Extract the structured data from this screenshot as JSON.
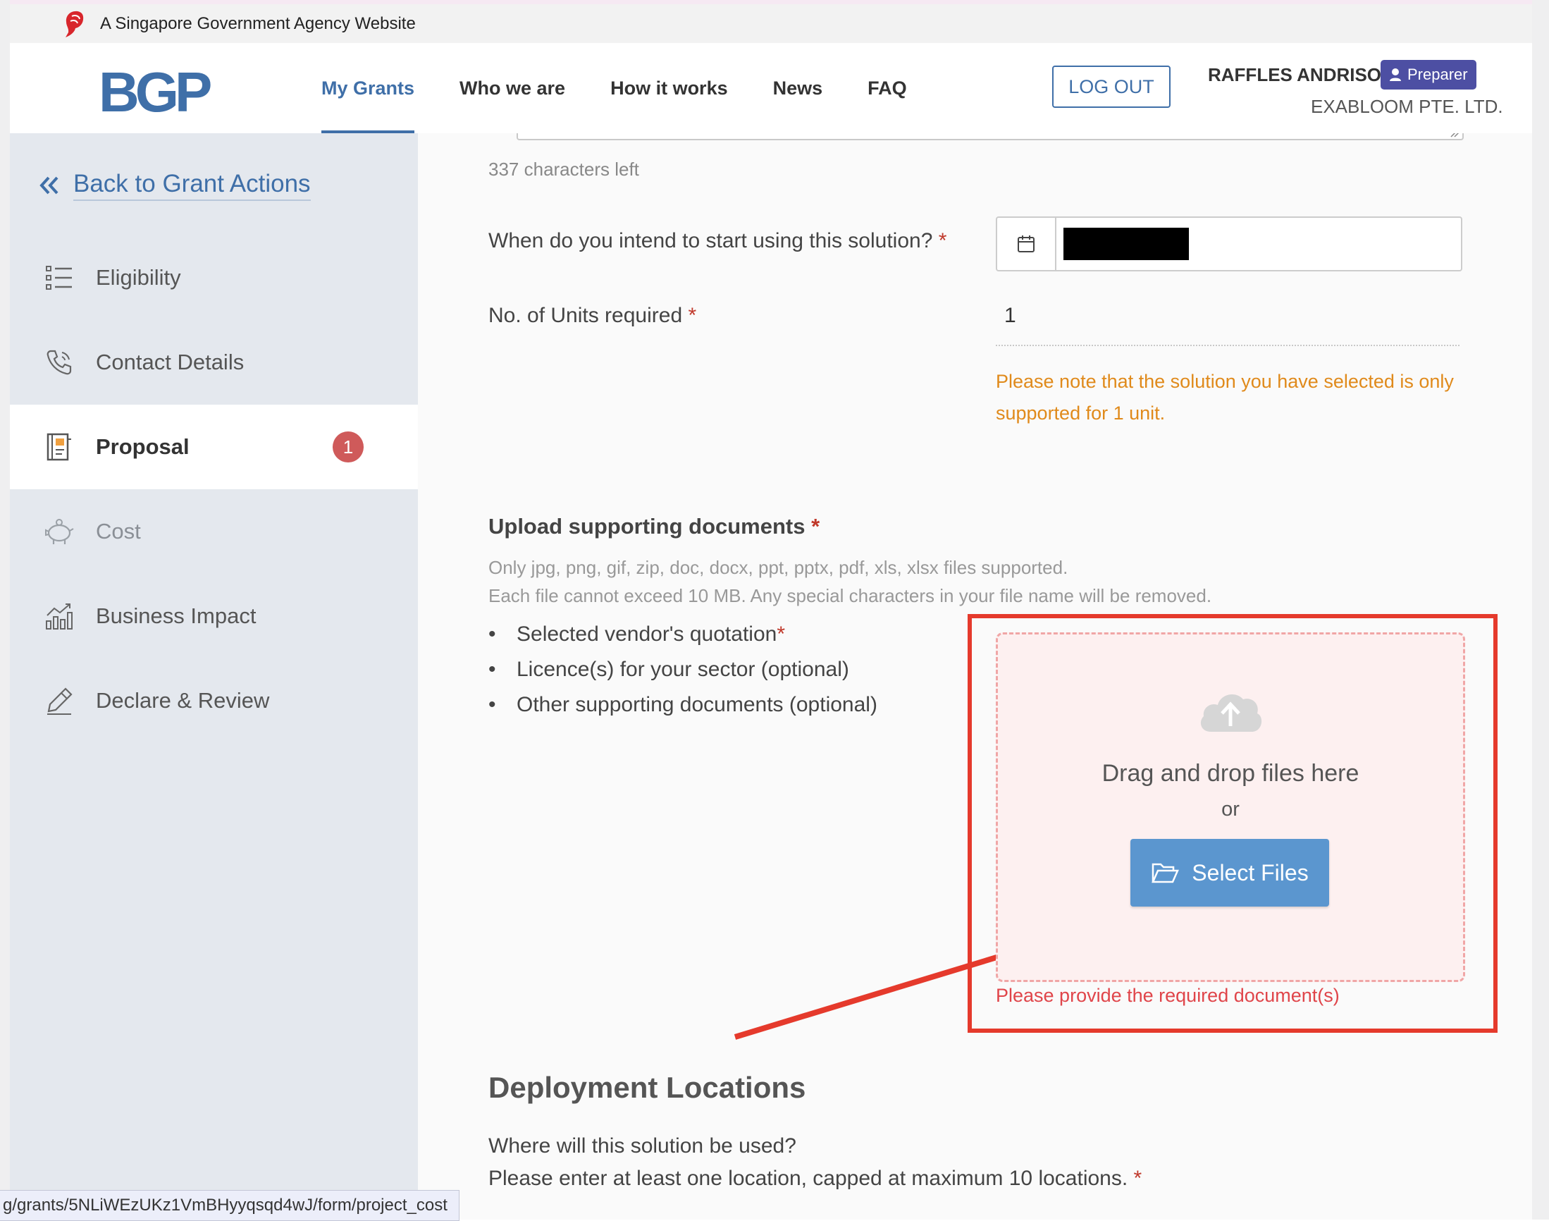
{
  "masthead": {
    "text": "A Singapore Government Agency Website"
  },
  "header": {
    "logo": "BGP",
    "nav": [
      {
        "label": "My Grants",
        "active": true
      },
      {
        "label": "Who we are"
      },
      {
        "label": "How it works"
      },
      {
        "label": "News"
      },
      {
        "label": "FAQ"
      }
    ],
    "logout_label": "LOG OUT",
    "user_name": "RAFFLES ANDRISON",
    "role": "Preparer",
    "company": "EXABLOOM PTE. LTD."
  },
  "sidebar": {
    "back_label": "Back to Grant Actions",
    "items": [
      {
        "label": "Eligibility",
        "icon": "list-icon"
      },
      {
        "label": "Contact Details",
        "icon": "phone-icon"
      },
      {
        "label": "Proposal",
        "icon": "notebook-icon",
        "active": true,
        "badge": "1"
      },
      {
        "label": "Cost",
        "icon": "piggy-bank-icon",
        "disabled": true
      },
      {
        "label": "Business Impact",
        "icon": "chart-icon"
      },
      {
        "label": "Declare & Review",
        "icon": "pen-icon"
      }
    ]
  },
  "form": {
    "chars_left": "337 characters left",
    "start_question": "When do you intend to start using this solution?",
    "units_question": "No. of Units required",
    "units_value": "1",
    "units_note": "Please note that the solution you have selected is only supported for 1 unit.",
    "required_mark": "*",
    "upload": {
      "title": "Upload supporting documents",
      "help_line1": "Only jpg, png, gif, zip, doc, docx, ppt, pptx, pdf, xls, xlsx files supported.",
      "help_line2": "Each file cannot exceed 10 MB. Any special characters in your file name will be removed.",
      "docs": [
        {
          "label": "Selected vendor's quotation",
          "required": true
        },
        {
          "label": "Licence(s) for your sector (optional)"
        },
        {
          "label": "Other supporting documents (optional)"
        }
      ],
      "drop_text": "Drag and drop files here",
      "or_text": "or",
      "select_label": "Select Files",
      "error": "Please provide the required document(s)"
    },
    "deployment": {
      "title": "Deployment Locations",
      "question": "Where will this solution be used?",
      "instruction": "Please enter at least one location, capped at maximum 10 locations."
    }
  },
  "status_bar": {
    "url": "g/grants/5NLiWEzUKz1VmBHyyqsqd4wJ/form/project_cost"
  },
  "colors": {
    "brand": "#3f6fa8",
    "highlight": "#e53a2c",
    "error": "#e0454a",
    "warning": "#e08a1b",
    "badge": "#cf5a5a",
    "role_badge": "#4d4fa3"
  }
}
